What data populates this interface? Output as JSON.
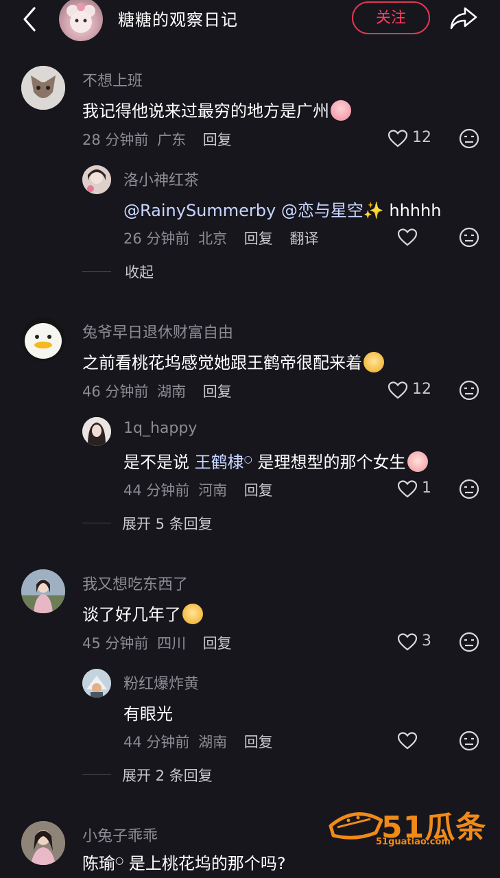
{
  "header": {
    "title": "糖糖的观察日记",
    "follow_label": "关注"
  },
  "comments": [
    {
      "author": "不想上班",
      "text": "我记得他说来过最穷的地方是广州",
      "time": "28 分钟前",
      "location": "广东",
      "reply_label": "回复",
      "likes": "12",
      "replies": [
        {
          "author": "洛小神红茶",
          "text_mention": "@RainySummerby @恋与星空✨",
          "text_rest": " hhhhh",
          "time": "26 分钟前",
          "location": "北京",
          "reply_label": "回复",
          "translate_label": "翻译"
        }
      ],
      "collapse_label": "收起"
    },
    {
      "author": "兔爷早日退休财富自由",
      "text": "之前看桃花坞感觉她跟王鹤帝很配来着",
      "time": "46 分钟前",
      "location": "湖南",
      "reply_label": "回复",
      "likes": "12",
      "replies": [
        {
          "author": "1q_happy",
          "text_before": "是不是说 ",
          "text_link": "王鹤棣",
          "text_after": " 是理想型的那个女生",
          "time": "44 分钟前",
          "location": "河南",
          "reply_label": "回复",
          "likes": "1"
        }
      ],
      "expand_label": "展开 5 条回复"
    },
    {
      "author": "我又想吃东西了",
      "text": "谈了好几年了",
      "time": "45 分钟前",
      "location": "四川",
      "reply_label": "回复",
      "likes": "3",
      "replies": [
        {
          "author": "粉红爆炸黄",
          "text": "有眼光",
          "time": "44 分钟前",
          "location": "湖南",
          "reply_label": "回复"
        }
      ],
      "expand_label": "展开 2 条回复"
    },
    {
      "author": "小兔子乖乖",
      "text_link": "陈瑜",
      "text_after": " 是上桃花坞的那个吗?"
    }
  ],
  "watermark": {
    "brand": "51瓜条",
    "url": "51guatiao.com"
  },
  "colors": {
    "background": "#17161d",
    "accent": "#e23753",
    "secondary_text": "#8d8c93",
    "watermark": "#f08a18"
  }
}
